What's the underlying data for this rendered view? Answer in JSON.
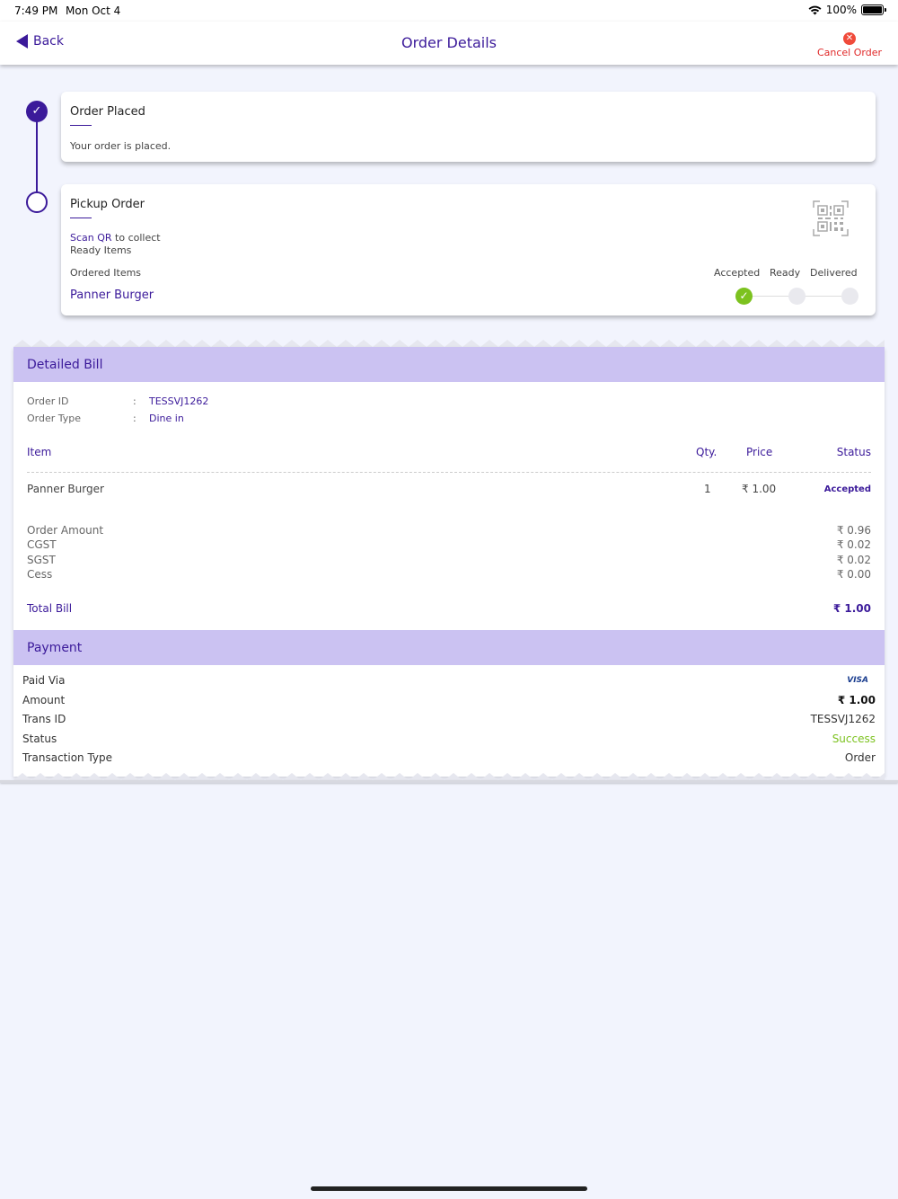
{
  "status_bar": {
    "time": "7:49 PM",
    "date": "Mon Oct 4",
    "battery": "100%"
  },
  "nav": {
    "back_label": "Back",
    "title": "Order Details",
    "cancel_label": "Cancel Order"
  },
  "timeline": {
    "placed": {
      "title": "Order Placed",
      "text": "Your order is placed."
    },
    "pickup": {
      "title": "Pickup Order",
      "scan_link": "Scan QR",
      "scan_rest": " to collect",
      "ready_text": "Ready Items",
      "ordered_label": "Ordered Items",
      "item": "Panner Burger",
      "stages": [
        "Accepted",
        "Ready",
        "Delivered"
      ],
      "current_stage": "Accepted"
    }
  },
  "bill": {
    "title": "Detailed Bill",
    "order_id_label": "Order ID",
    "order_id": "TESSVJ1262",
    "order_type_label": "Order Type",
    "order_type": "Dine in",
    "colon": ":",
    "columns": {
      "item": "Item",
      "qty": "Qty.",
      "price": "Price",
      "status": "Status"
    },
    "rows": [
      {
        "item": "Panner Burger",
        "qty": "1",
        "price": "₹ 1.00",
        "status": "Accepted"
      }
    ],
    "summary": [
      {
        "label": "Order Amount",
        "value": "₹ 0.96"
      },
      {
        "label": "CGST",
        "value": "₹ 0.02"
      },
      {
        "label": "SGST",
        "value": "₹ 0.02"
      },
      {
        "label": "Cess",
        "value": "₹ 0.00"
      }
    ],
    "total_label": "Total Bill",
    "total_value": "₹ 1.00"
  },
  "payment": {
    "title": "Payment",
    "paid_via_label": "Paid Via",
    "paid_via": "VISA",
    "amount_label": "Amount",
    "amount": "₹ 1.00",
    "trans_id_label": "Trans ID",
    "trans_id": "TESSVJ1262",
    "status_label": "Status",
    "status": "Success",
    "type_label": "Transaction Type",
    "type": "Order"
  },
  "colors": {
    "primary": "#3b1a9a",
    "header_bg": "#cbc2f2",
    "success": "#7cc21f",
    "danger": "#e02828",
    "page_bg": "#f2f4fd"
  }
}
